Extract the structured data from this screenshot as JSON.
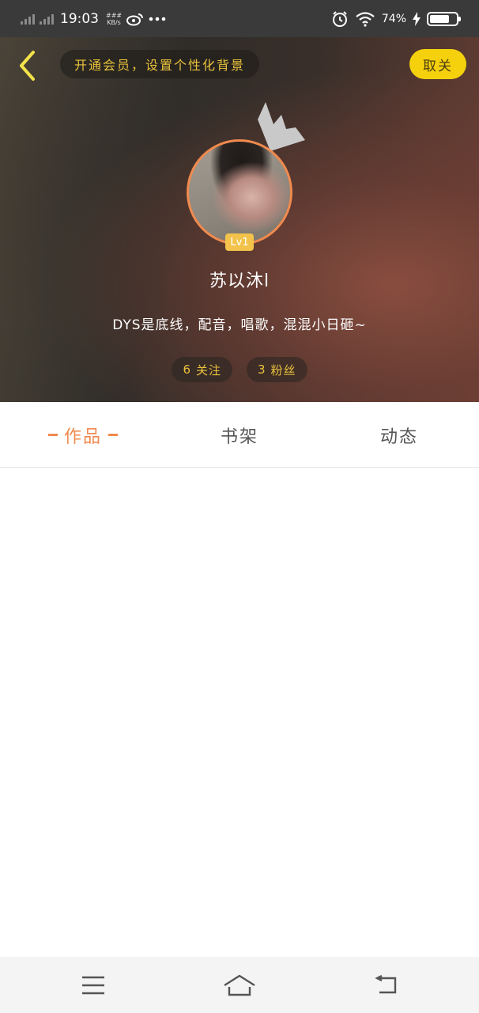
{
  "status_bar": {
    "time": "19:03",
    "net_speed_value": "###",
    "net_speed_unit": "KB/s",
    "battery_percent": "74%",
    "battery_level": 0.74,
    "icons": [
      "signal-icon",
      "weibo-icon",
      "more-dots-icon",
      "alarm-icon",
      "wifi-icon",
      "charging-icon",
      "battery-icon"
    ]
  },
  "header": {
    "vip_banner": "开通会员，设置个性化背景",
    "cancel_follow": "取关",
    "level": "Lv1",
    "username": "苏以沐l",
    "bio": "DYS是底线，配音，唱歌，混混小日砸~",
    "stats": [
      {
        "count": "6",
        "label": "关注"
      },
      {
        "count": "3",
        "label": "粉丝"
      }
    ]
  },
  "tabs": [
    {
      "label": "作品",
      "active": true
    },
    {
      "label": "书架",
      "active": false
    },
    {
      "label": "动态",
      "active": false
    }
  ],
  "colors": {
    "accent": "#f08a4e",
    "vip_gold": "#e9c23c",
    "button_yellow": "#f5d10d"
  },
  "nav_bar": {
    "icons": [
      "menu-icon",
      "home-icon",
      "back-icon"
    ]
  }
}
